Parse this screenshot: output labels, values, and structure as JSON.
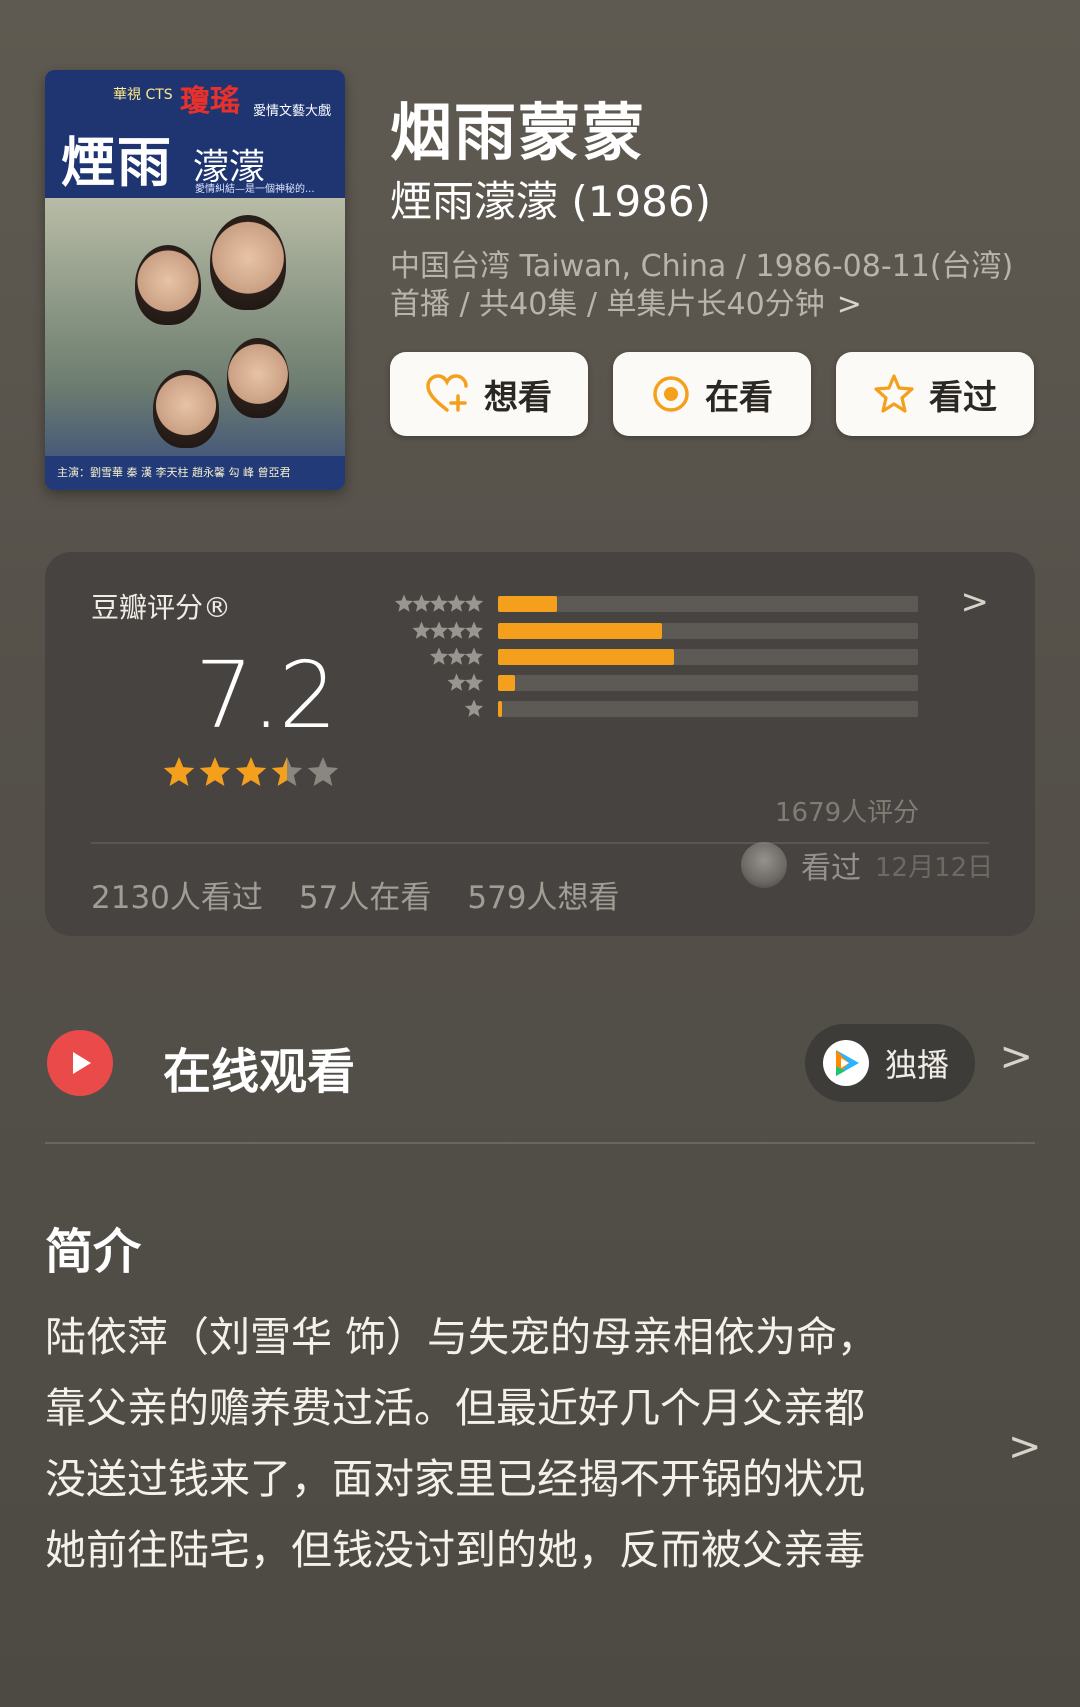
{
  "poster": {
    "logo": "華視 CTS",
    "brand": "瓊瑤",
    "brand_sub": "愛情文藝大戲",
    "title_large": "煙雨",
    "title_small": "濛濛",
    "tagline": "愛情糾結—是一個神秘的...",
    "cast": "主演：劉雪華 秦 漢 李天柱 趙永馨 勾 峰 曾亞君"
  },
  "header": {
    "title": "烟雨蒙蒙",
    "subtitle": "煙雨濛濛 (1986)",
    "meta_line1": "中国台湾 Taiwan, China / 1986-08-11(台湾)",
    "meta_line2": "首播 / 共40集 / 单集片长40分钟",
    "meta_chevron": ">"
  },
  "actions": [
    {
      "label": "想看",
      "icon": "heart-plus-icon"
    },
    {
      "label": "在看",
      "icon": "target-icon"
    },
    {
      "label": "看过",
      "icon": "star-outline-icon"
    }
  ],
  "colors": {
    "accent": "#f5a01d",
    "play_red": "#ea4a4a",
    "card_bg": "#464340"
  },
  "rating": {
    "label": "豆瓣评分®",
    "chevron": ">",
    "score": "7.2",
    "score_stars": 3.5,
    "distribution": [
      {
        "stars": 5,
        "percent": 14
      },
      {
        "stars": 4,
        "percent": 39
      },
      {
        "stars": 3,
        "percent": 42
      },
      {
        "stars": 2,
        "percent": 4
      },
      {
        "stars": 1,
        "percent": 1
      }
    ],
    "count": "1679人评分",
    "stats": [
      "2130人看过",
      "57人在看",
      "579人想看"
    ],
    "seen_label": "看过",
    "seen_date": "12月12日"
  },
  "online": {
    "title": "在线观看",
    "exclusive": "独播",
    "chevron": ">"
  },
  "intro": {
    "title": "简介",
    "lines": [
      "陆依萍（刘雪华 饰）与失宠的母亲相依为命，",
      "靠父亲的赡养费过活。但最近好几个月父亲都",
      "没送过钱来了，面对家里已经揭不开锅的状况",
      "她前往陆宅，但钱没讨到的她，反而被父亲毒"
    ],
    "chevron": ">"
  }
}
